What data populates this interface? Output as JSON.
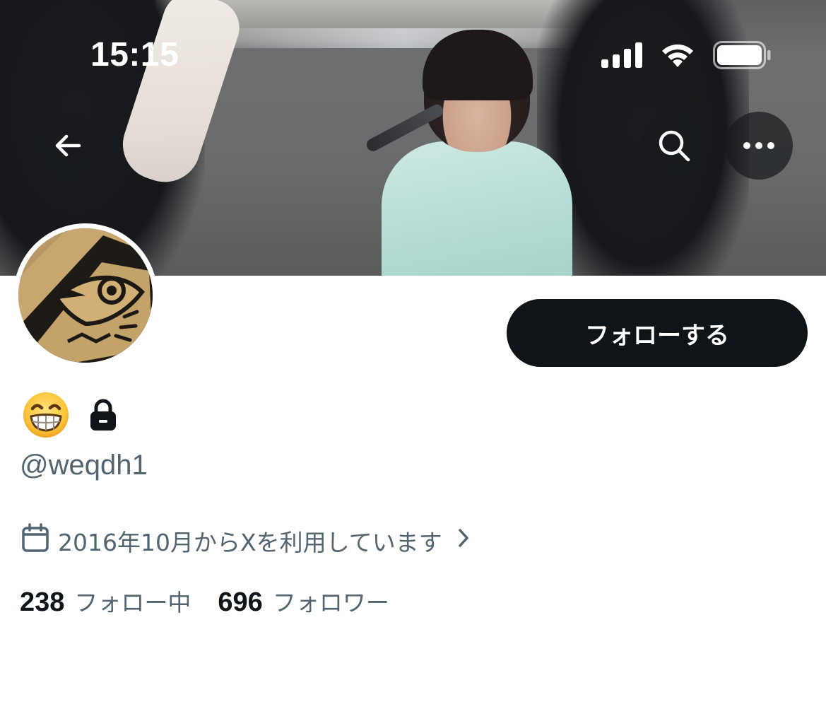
{
  "status_bar": {
    "time": "15:15",
    "signal_icon": "cellular-signal-icon",
    "wifi_icon": "wifi-icon",
    "battery_icon": "battery-icon"
  },
  "nav": {
    "back_icon": "arrow-left-icon",
    "search_icon": "search-icon",
    "more_icon": "more-horizontal-icon"
  },
  "profile": {
    "display_name_emoji": "😁",
    "protected_icon": "lock-icon",
    "handle": "@weqdh1",
    "joined_text": "2016年10月からXを利用しています",
    "joined_icon": "calendar-icon",
    "joined_chevron_icon": "chevron-right-icon",
    "follow_button_label": "フォローする"
  },
  "stats": {
    "following_count": "238",
    "following_label": "フォロー中",
    "followers_count": "696",
    "followers_label": "フォロワー"
  },
  "colors": {
    "primary_text": "#0f1419",
    "secondary_text": "#536471",
    "follow_button_bg": "#0f1419",
    "follow_button_text": "#ffffff"
  }
}
